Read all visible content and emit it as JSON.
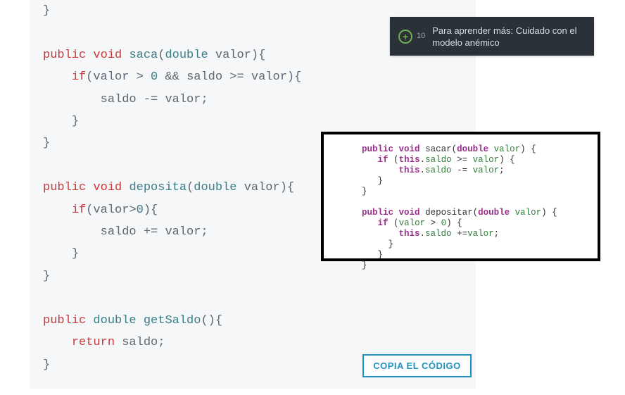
{
  "main_code": {
    "tokens": {
      "kw_public": "public",
      "kw_void": "void",
      "kw_if": "if",
      "kw_return": "return",
      "t_double": "double",
      "fn_saca": "saca",
      "fn_deposita": "deposita",
      "fn_getSaldo": "getSaldo",
      "id_valor": "valor",
      "id_saldo": "saldo",
      "num_zero": "0"
    }
  },
  "copy_button": {
    "label": "COPIA EL CÓDIGO"
  },
  "overlay": {
    "icon": "+",
    "count": "10",
    "text": "Para aprender más: Cuidado con el modelo anémico"
  },
  "snippet_code": {
    "tokens": {
      "kw_public": "public",
      "kw_void": "void",
      "kw_if": "if",
      "kw_this": "this",
      "t_double": "double",
      "fn_sacar": "sacar",
      "fn_depositar": "depositar",
      "id_valor": "valor",
      "id_saldo": "saldo",
      "num_zero": "0"
    }
  }
}
